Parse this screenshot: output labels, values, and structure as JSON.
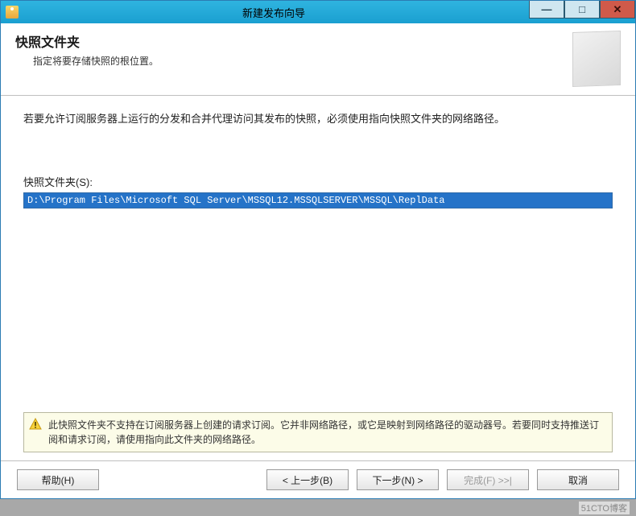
{
  "window": {
    "title": "新建发布向导"
  },
  "header": {
    "title": "快照文件夹",
    "subtitle": "指定将要存储快照的根位置。"
  },
  "content": {
    "intro": "若要允许订阅服务器上运行的分发和合并代理访问其发布的快照，必须使用指向快照文件夹的网络路径。",
    "field_label": "快照文件夹(S):",
    "path_value": "D:\\Program Files\\Microsoft SQL Server\\MSSQL12.MSSQLSERVER\\MSSQL\\ReplData",
    "warning": "此快照文件夹不支持在订阅服务器上创建的请求订阅。它并非网络路径，或它是映射到网络路径的驱动器号。若要同时支持推送订阅和请求订阅，请使用指向此文件夹的网络路径。"
  },
  "footer": {
    "help": "帮助(H)",
    "back": "< 上一步(B)",
    "next": "下一步(N) >",
    "finish": "完成(F) >>|",
    "cancel": "取消"
  },
  "watermark": "51CTO博客"
}
